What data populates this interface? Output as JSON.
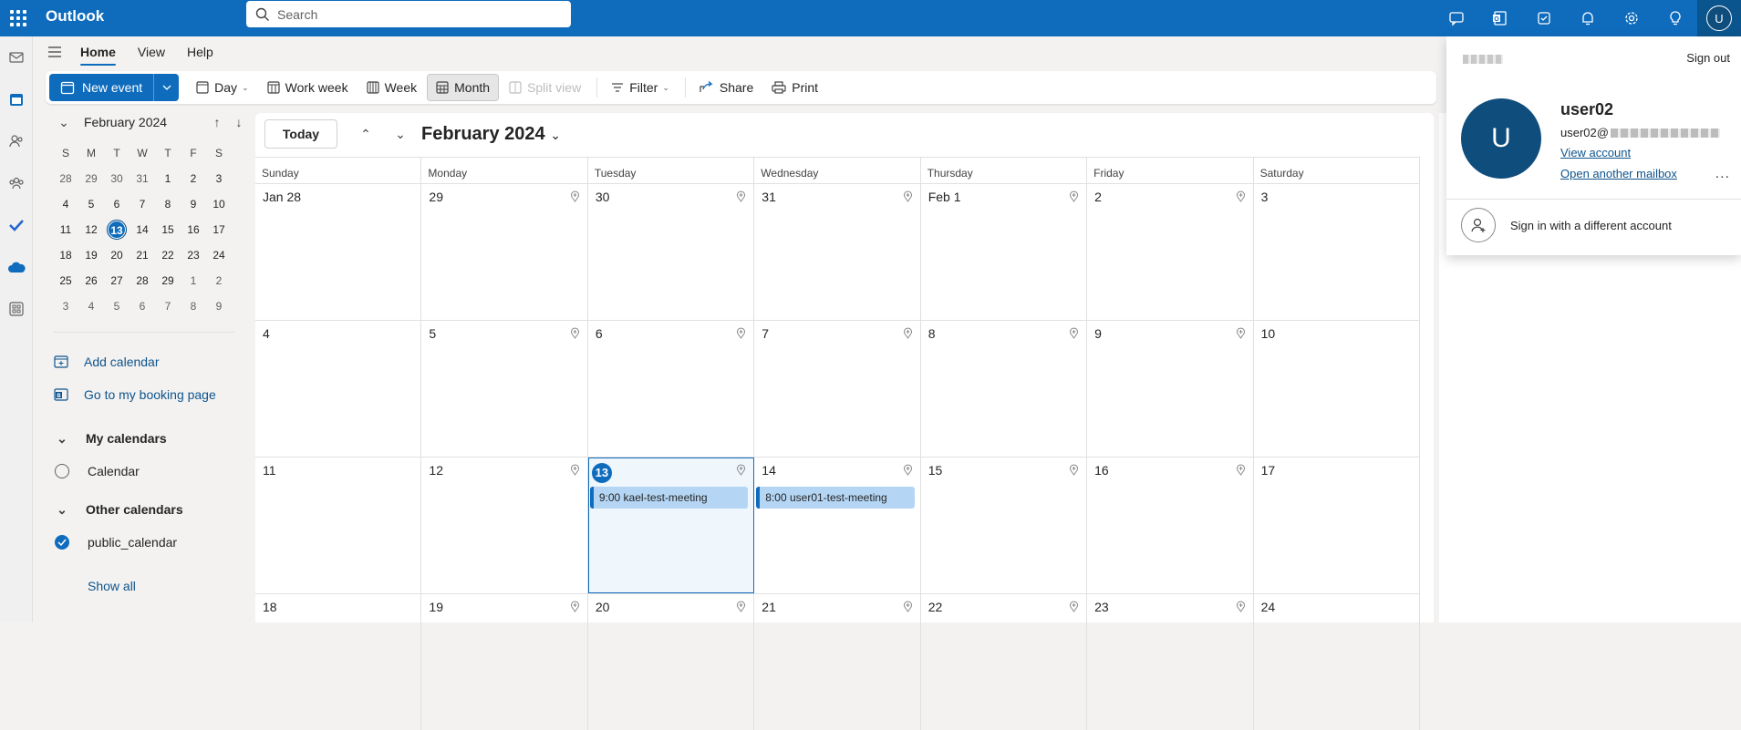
{
  "app": {
    "title": "Outlook"
  },
  "search": {
    "placeholder": "Search"
  },
  "ribbon": {
    "tabs": [
      "Home",
      "View",
      "Help"
    ]
  },
  "toolbar": {
    "new_event": "New event",
    "day": "Day",
    "work_week": "Work week",
    "week": "Week",
    "month": "Month",
    "split_view": "Split view",
    "filter": "Filter",
    "share": "Share",
    "print": "Print"
  },
  "mini_calendar": {
    "title": "February 2024",
    "dow": [
      "S",
      "M",
      "T",
      "W",
      "T",
      "F",
      "S"
    ],
    "weeks": [
      [
        "28",
        "29",
        "30",
        "31",
        "1",
        "2",
        "3"
      ],
      [
        "4",
        "5",
        "6",
        "7",
        "8",
        "9",
        "10"
      ],
      [
        "11",
        "12",
        "13",
        "14",
        "15",
        "16",
        "17"
      ],
      [
        "18",
        "19",
        "20",
        "21",
        "22",
        "23",
        "24"
      ],
      [
        "25",
        "26",
        "27",
        "28",
        "29",
        "1",
        "2"
      ],
      [
        "3",
        "4",
        "5",
        "6",
        "7",
        "8",
        "9"
      ]
    ],
    "today": "13"
  },
  "sidebar": {
    "add_calendar": "Add calendar",
    "booking_page": "Go to my booking page",
    "my_calendars": "My calendars",
    "my_calendar_items": [
      "Calendar"
    ],
    "other_calendars": "Other calendars",
    "other_calendar_items": [
      "public_calendar"
    ],
    "show_all": "Show all"
  },
  "main": {
    "today_button": "Today",
    "month_title": "February 2024",
    "dow": [
      "Sunday",
      "Monday",
      "Tuesday",
      "Wednesday",
      "Thursday",
      "Friday",
      "Saturday"
    ],
    "weeks": [
      [
        "Jan 28",
        "29",
        "30",
        "31",
        "Feb 1",
        "2",
        "3"
      ],
      [
        "4",
        "5",
        "6",
        "7",
        "8",
        "9",
        "10"
      ],
      [
        "11",
        "12",
        "13",
        "14",
        "15",
        "16",
        "17"
      ],
      [
        "18",
        "19",
        "20",
        "21",
        "22",
        "23",
        "24"
      ]
    ],
    "events": [
      {
        "time": "9:00",
        "title": "kael-test-meeting"
      },
      {
        "time": "8:00",
        "title": "user01-test-meeting"
      }
    ]
  },
  "account": {
    "sign_out": "Sign out",
    "avatar_initial": "U",
    "name": "user02",
    "email_prefix": "user02@",
    "view_account": "View account",
    "open_mailbox": "Open another mailbox",
    "more": "...",
    "sign_in_different": "Sign in with a different account"
  },
  "colors": {
    "brand": "#0f6cbd",
    "event_fill": "#b4d6f4"
  }
}
